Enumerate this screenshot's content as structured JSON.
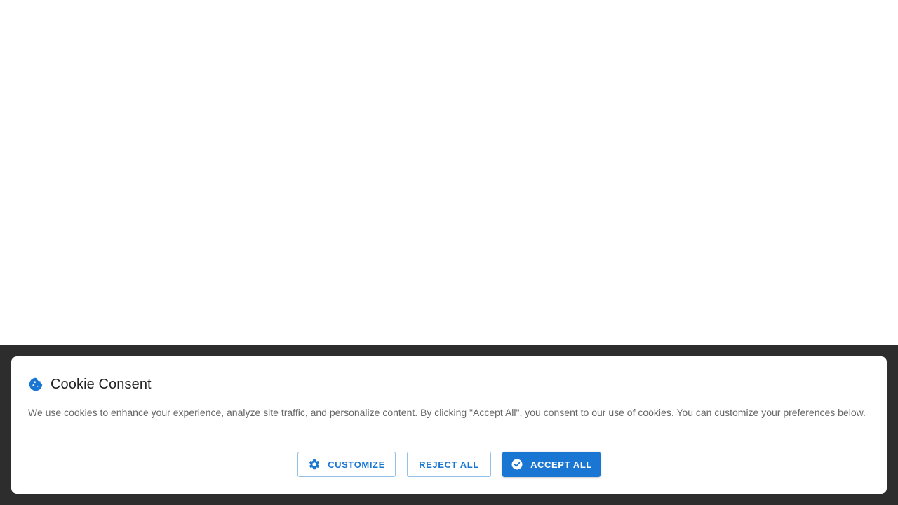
{
  "consent": {
    "title": "Cookie Consent",
    "icon": "cookie-icon",
    "description": "We use cookies to enhance your experience, analyze site traffic, and personalize content. By clicking \"Accept All\", you consent to our use of cookies. You can customize your preferences below.",
    "buttons": {
      "customize": {
        "label": "CUSTOMIZE",
        "icon": "gear-icon"
      },
      "reject": {
        "label": "REJECT ALL"
      },
      "accept": {
        "label": "ACCEPT ALL",
        "icon": "check-circle-icon"
      }
    }
  },
  "colors": {
    "accent": "#1976d2",
    "overlay": "#2d2d2d",
    "card": "#ffffff",
    "title_text": "#222222",
    "body_text": "#666666"
  }
}
